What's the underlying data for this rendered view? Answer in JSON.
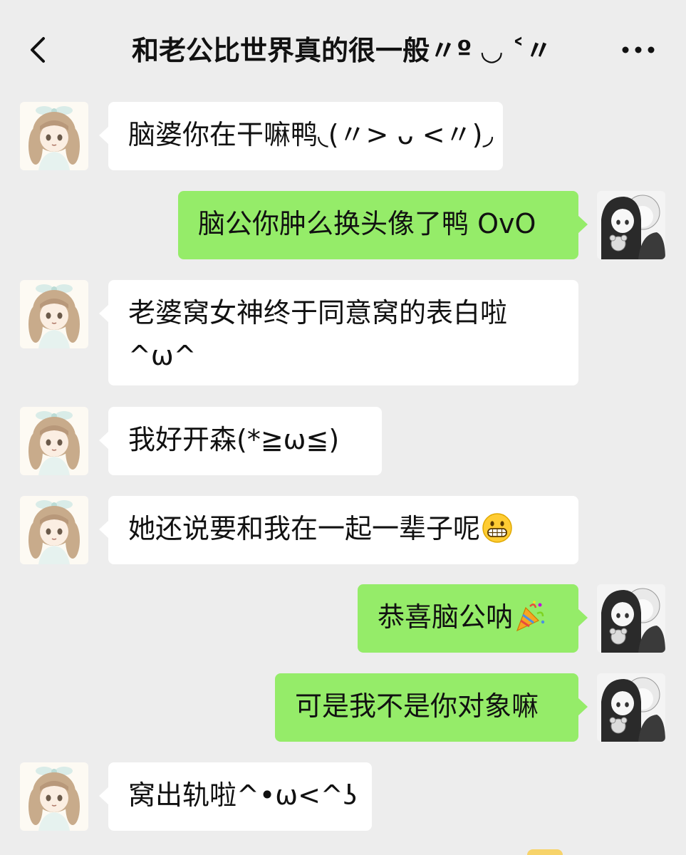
{
  "header": {
    "title": "和老公比世界真的很一般〃º ◡ ˂〃",
    "back_icon": "chevron-left-icon",
    "more_icon": "more-dots-icon"
  },
  "messages": [
    {
      "side": "in",
      "text": "脑婆你在干嘛鸭◟(〃> ᴗ <〃)◞"
    },
    {
      "side": "out",
      "text": "脑公你肿么换头像了鸭 OvO"
    },
    {
      "side": "in",
      "text": "老婆窝女神终于同意窝的表白啦^ω^"
    },
    {
      "side": "in",
      "text": "我好开森(*≧ω≦)"
    },
    {
      "side": "in",
      "text": "她还说要和我在一起一辈子呢",
      "emoji": "grinning-face-icon"
    },
    {
      "side": "out",
      "text": "恭喜脑公呐",
      "emoji": "party-popper-icon"
    },
    {
      "side": "out",
      "text": "可是我不是你对象嘛"
    },
    {
      "side": "in",
      "text": "窝出轨啦^•ω<^ʖ"
    }
  ],
  "colors": {
    "background": "#ededed",
    "incoming_bubble": "#ffffff",
    "outgoing_bubble": "#95ec69",
    "text": "#111111"
  }
}
